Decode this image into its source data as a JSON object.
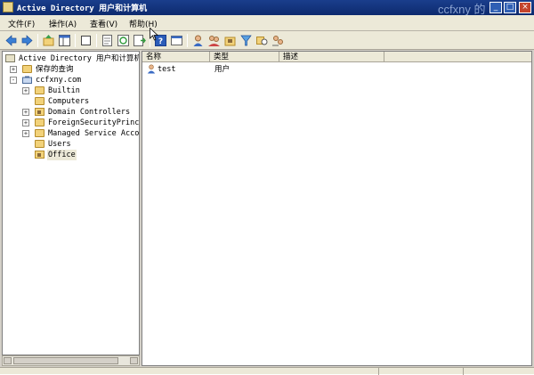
{
  "window": {
    "title": "Active Directory 用户和计算机",
    "watermark": "ccfxny 的",
    "buttons": {
      "minimize": "_",
      "maximize": "□",
      "close": "×"
    }
  },
  "menubar": {
    "items": [
      {
        "label": "文件(F)"
      },
      {
        "label": "操作(A)"
      },
      {
        "label": "查看(V)"
      },
      {
        "label": "帮助(H)"
      }
    ]
  },
  "toolbar": {
    "icons": [
      "back-icon",
      "forward-icon",
      "up-icon",
      "show-hide-tree-icon",
      "delete-icon",
      "properties-icon",
      "refresh-icon",
      "export-list-icon",
      "help-icon",
      "console-icon",
      "new-user-icon",
      "new-group-icon",
      "new-ou-icon",
      "filter-icon",
      "find-icon",
      "add-to-group-icon"
    ]
  },
  "tree": {
    "root": "Active Directory 用户和计算机",
    "items": [
      {
        "label": "保存的查询",
        "expander": "+"
      },
      {
        "label": "ccfxny.com",
        "expander": "-"
      },
      {
        "label": "Builtin",
        "expander": "+"
      },
      {
        "label": "Computers",
        "expander": ""
      },
      {
        "label": "Domain Controllers",
        "expander": "+"
      },
      {
        "label": "ForeignSecurityPrincip",
        "expander": "+"
      },
      {
        "label": "Managed Service Accour",
        "expander": "+"
      },
      {
        "label": "Users",
        "expander": ""
      },
      {
        "label": "Office",
        "expander": "",
        "selected": true
      }
    ]
  },
  "list": {
    "columns": [
      "名称",
      "类型",
      "描述"
    ],
    "rows": [
      {
        "name": "test",
        "type": "用户",
        "description": ""
      }
    ]
  }
}
